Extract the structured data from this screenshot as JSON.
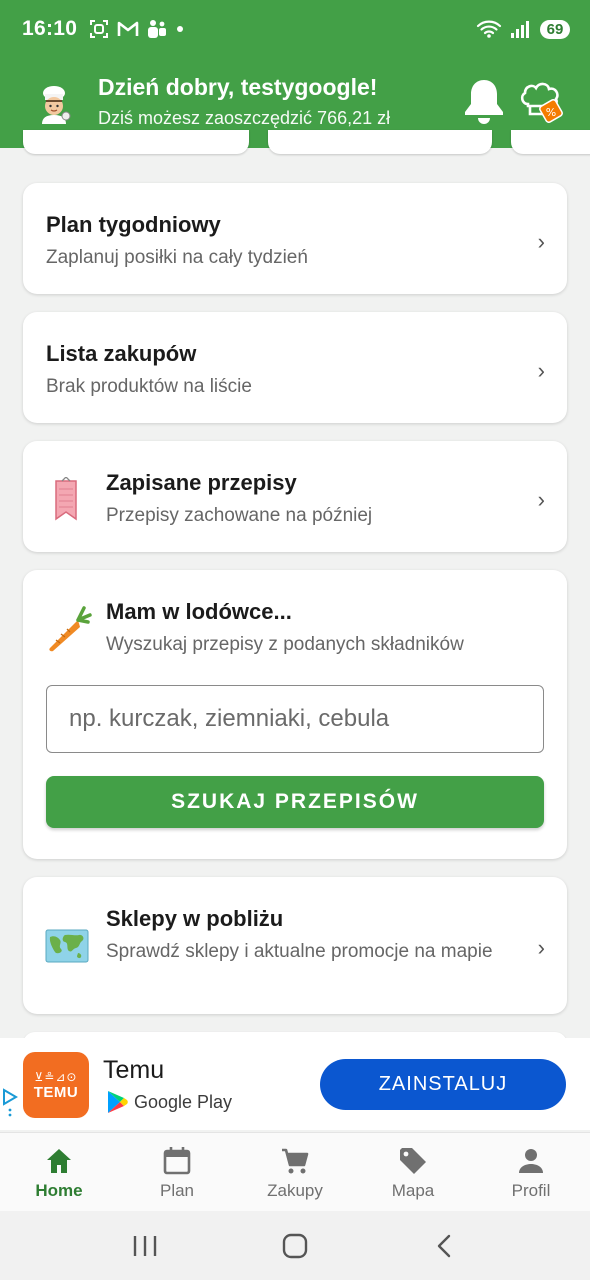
{
  "status_bar": {
    "time": "16:10",
    "battery": "69",
    "notification_icons": [
      "screenshot-icon",
      "gmail-icon",
      "teams-icon",
      "dot-icon"
    ],
    "system_icons": [
      "wifi-icon",
      "signal-icon",
      "battery-icon"
    ]
  },
  "header": {
    "greeting": "Dzień dobry, testygoogle!",
    "saving_text": "Dziś możesz zaoszczędzić 766,21 zł",
    "icons": [
      "chef-avatar-icon",
      "bell-icon",
      "chef-hat-discount-icon"
    ]
  },
  "cards": {
    "plan": {
      "title": "Plan tygodniowy",
      "subtitle": "Zaplanuj posiłki na cały tydzień",
      "chevron": "›"
    },
    "shopping": {
      "title": "Lista zakupów",
      "subtitle": "Brak produktów na liście",
      "chevron": "›"
    },
    "saved": {
      "title": "Zapisane przepisy",
      "subtitle": "Przepisy zachowane na później",
      "chevron": "›",
      "icon": "bookmark-icon"
    },
    "fridge": {
      "title": "Mam w lodówce...",
      "subtitle": "Wyszukaj przepisy z podanych składników",
      "icon": "carrot-icon",
      "input_value": "",
      "input_placeholder": "np. kurczak, ziemniaki, cebula",
      "button_label": "SZUKAJ PRZEPISÓW"
    },
    "stores": {
      "title": "Sklepy w pobliżu",
      "subtitle": "Sprawdź sklepy i aktualne promocje na mapie",
      "chevron": "›",
      "icon": "world-map-icon"
    }
  },
  "ad": {
    "app_name": "Temu",
    "logo_text": "TEMU",
    "logo_glyphs": "⊻≗⊿⊙",
    "store_label": "Google Play",
    "install_label": "ZAINSTALUJ"
  },
  "bottom_nav": [
    {
      "label": "Home",
      "icon": "home-icon",
      "active": true
    },
    {
      "label": "Plan",
      "icon": "calendar-icon",
      "active": false
    },
    {
      "label": "Zakupy",
      "icon": "cart-icon",
      "active": false
    },
    {
      "label": "Mapa",
      "icon": "tag-icon",
      "active": false
    },
    {
      "label": "Profil",
      "icon": "person-icon",
      "active": false
    }
  ],
  "system_nav": [
    "recents-icon",
    "home-button-icon",
    "back-icon"
  ],
  "colors": {
    "primary_green": "#43a047",
    "install_blue": "#0b57d0",
    "temu_orange": "#f26d21",
    "active_nav": "#2e7d32"
  }
}
